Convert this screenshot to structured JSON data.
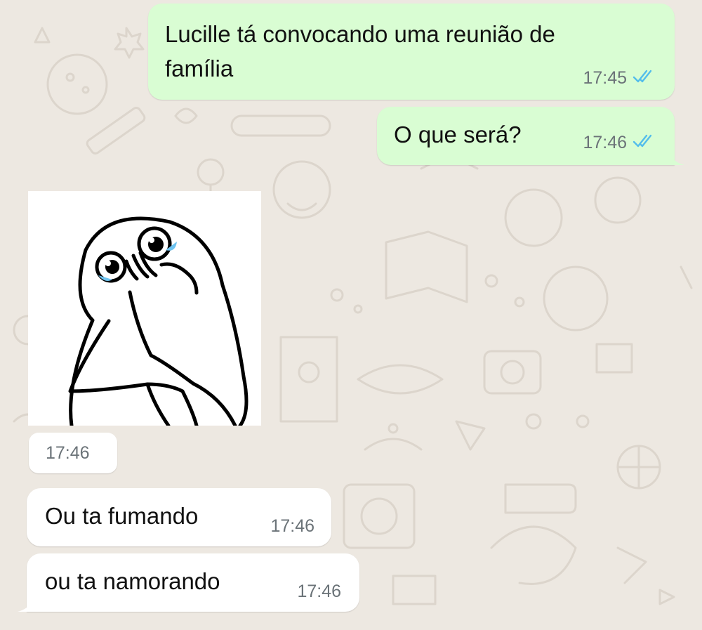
{
  "chat": {
    "messages": [
      {
        "direction": "outgoing",
        "type": "text",
        "text": "Lucille tá convocando uma reunião de família",
        "line1": "Lucille tá convocando uma reunião de",
        "line2": "família",
        "time": "17:45",
        "status": "read"
      },
      {
        "direction": "outgoing",
        "type": "text",
        "text": "O que será?",
        "time": "17:46",
        "status": "read"
      },
      {
        "direction": "incoming",
        "type": "sticker",
        "sticker": "crying-meme-face",
        "time": "17:46"
      },
      {
        "direction": "incoming",
        "type": "text",
        "text": "Ou ta fumando",
        "time": "17:46"
      },
      {
        "direction": "incoming",
        "type": "text",
        "text": "ou ta namorando",
        "time": "17:46"
      }
    ]
  },
  "colors": {
    "wallpaper": "#ede8e1",
    "outgoing_bubble": "#d9fdd3",
    "incoming_bubble": "#ffffff",
    "read_ticks": "#53bdeb",
    "timestamp": "#6b7378"
  },
  "icons": {
    "read_status": "double-check-icon"
  }
}
